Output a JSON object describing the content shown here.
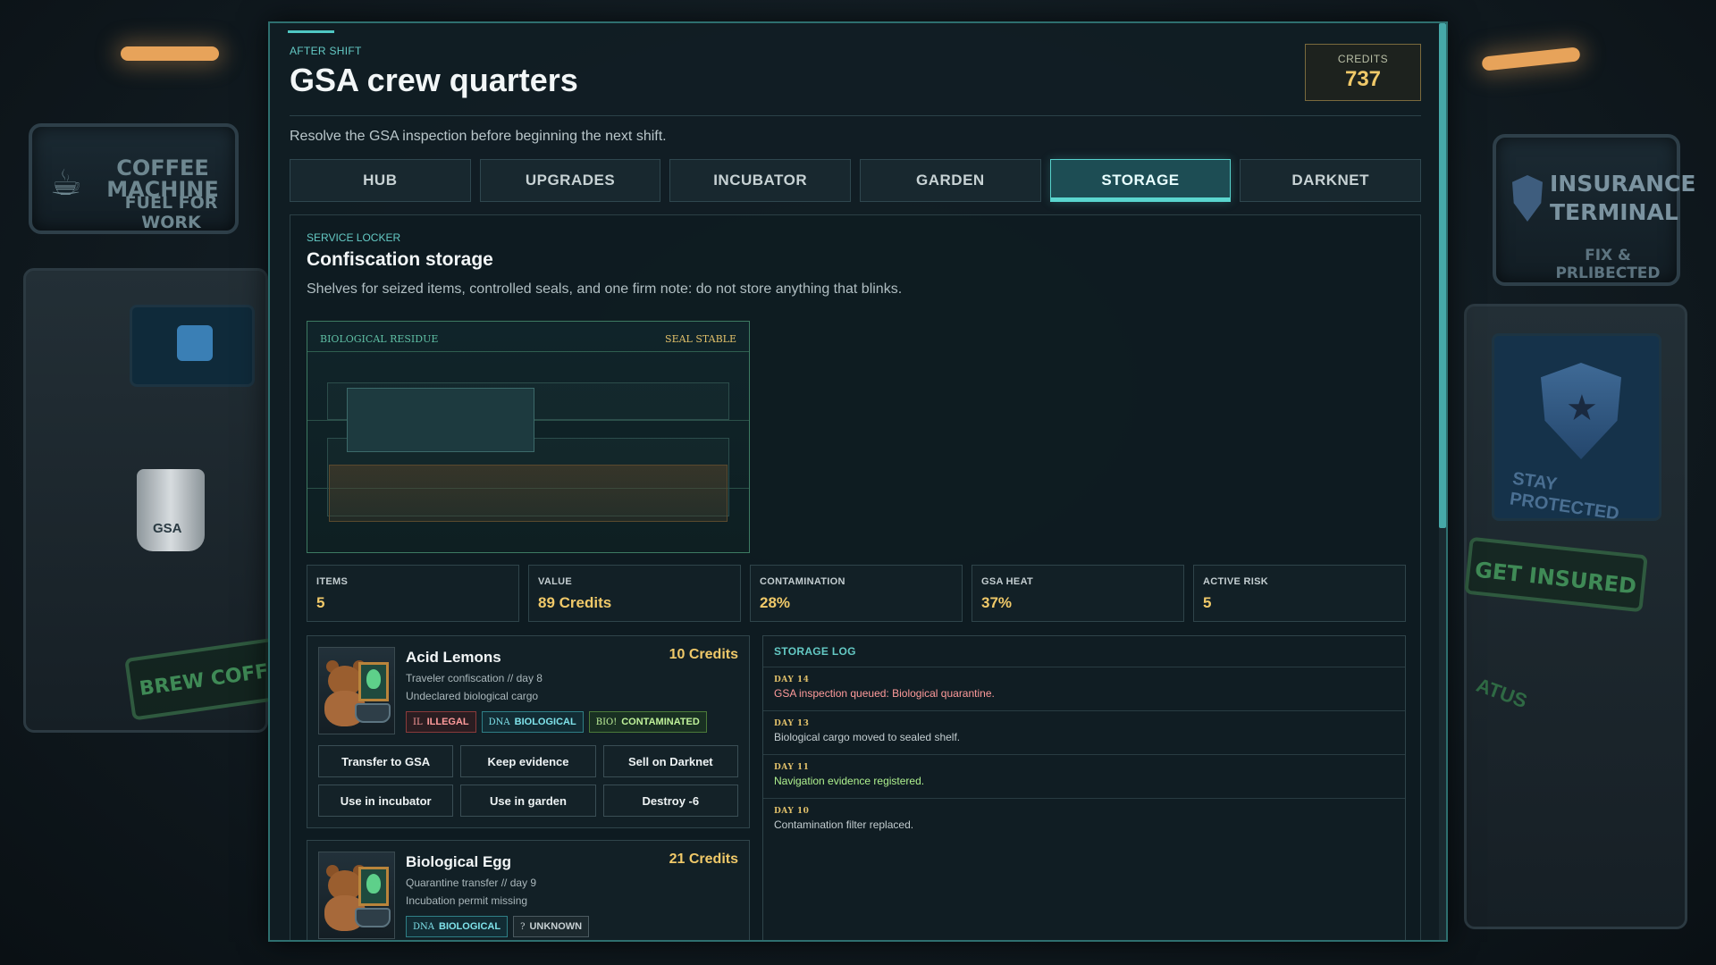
{
  "scene": {
    "left_sign_title": "COFFEE MACHINE",
    "left_sign_sub": "FUEL FOR WORK",
    "mug_label": "GSA",
    "brew_sign": "BREW COFFEE",
    "right_sign_title": "INSURANCE TERMINAL",
    "right_sign_sub": "FIX & PRLIBECTED",
    "shield_caption": "STAY PROTECTED",
    "insure_sign": "GET INSURED",
    "status_fragment": "ATUS"
  },
  "header": {
    "eyebrow": "AFTER SHIFT",
    "title": "GSA crew quarters",
    "credits_label": "CREDITS",
    "credits_value": "737"
  },
  "subtitle": "Resolve the GSA inspection before beginning the next shift.",
  "tabs": [
    {
      "label": "HUB",
      "active": false
    },
    {
      "label": "UPGRADES",
      "active": false
    },
    {
      "label": "INCUBATOR",
      "active": false
    },
    {
      "label": "GARDEN",
      "active": false
    },
    {
      "label": "STORAGE",
      "active": true
    },
    {
      "label": "DARKNET",
      "active": false
    }
  ],
  "section": {
    "eyebrow": "SERVICE LOCKER",
    "title": "Confiscation storage",
    "description": "Shelves for seized items, controlled seals, and one firm note: do not store anything that blinks."
  },
  "locker": {
    "label": "BIOLOGICAL RESIDUE",
    "status": "SEAL STABLE"
  },
  "stats": [
    {
      "label": "ITEMS",
      "value": "5"
    },
    {
      "label": "VALUE",
      "value": "89 Credits"
    },
    {
      "label": "CONTAMINATION",
      "value": "28%"
    },
    {
      "label": "GSA HEAT",
      "value": "37%"
    },
    {
      "label": "ACTIVE RISK",
      "value": "5"
    }
  ],
  "items": [
    {
      "name": "Acid Lemons",
      "price": "10 Credits",
      "line1": "Traveler confiscation // day 8",
      "line2": "Undeclared biological cargo",
      "tags": [
        {
          "code": "IL",
          "label": "ILLEGAL",
          "kind": "illegal"
        },
        {
          "code": "DNA",
          "label": "BIOLOGICAL",
          "kind": "bio"
        },
        {
          "code": "BIO!",
          "label": "CONTAMINATED",
          "kind": "cont"
        }
      ],
      "actions": [
        "Transfer to GSA",
        "Keep evidence",
        "Sell on Darknet",
        "Use in incubator",
        "Use in garden",
        "Destroy -6"
      ]
    },
    {
      "name": "Biological Egg",
      "price": "21 Credits",
      "line1": "Quarantine transfer // day 9",
      "line2": "Incubation permit missing",
      "tags": [
        {
          "code": "DNA",
          "label": "BIOLOGICAL",
          "kind": "bio"
        },
        {
          "code": "?",
          "label": "UNKNOWN",
          "kind": "unk"
        }
      ]
    }
  ],
  "log": {
    "title": "STORAGE LOG",
    "entries": [
      {
        "day": "DAY 14",
        "text": "GSA inspection queued: Biological quarantine.",
        "color": "#ff9b9b"
      },
      {
        "day": "DAY 13",
        "text": "Biological cargo moved to sealed shelf.",
        "color": "#c3cdd0"
      },
      {
        "day": "DAY 11",
        "text": "Navigation evidence registered.",
        "color": "#aef08e"
      },
      {
        "day": "DAY 10",
        "text": "Contamination filter replaced.",
        "color": "#c3cdd0"
      }
    ]
  }
}
